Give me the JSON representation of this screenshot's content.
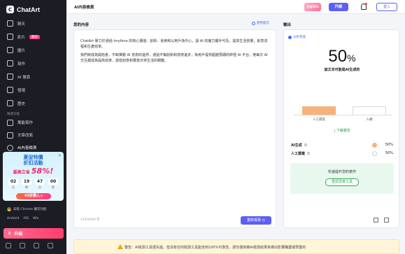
{
  "app": {
    "name": "ChatArt",
    "logo_letter": "C"
  },
  "sidebar": {
    "items": [
      {
        "label": "聊天",
        "icon": "chat-icon"
      },
      {
        "label": "影片",
        "icon": "video-icon",
        "badge": "最新"
      },
      {
        "label": "圖片",
        "icon": "image-icon"
      },
      {
        "label": "寫作",
        "icon": "pen-icon"
      },
      {
        "label": "AI 搜尋",
        "icon": "search-icon"
      },
      {
        "label": "發現",
        "icon": "compass-icon"
      },
      {
        "label": "歷史",
        "icon": "clock-icon"
      }
    ],
    "section_label": "精選功能",
    "features": [
      {
        "label": "萬能寫作",
        "icon": "magic-icon"
      },
      {
        "label": "文章改寫",
        "icon": "rewrite-icon"
      },
      {
        "label": "AI內容檢測",
        "icon": "check-icon",
        "active": true
      }
    ],
    "promo": {
      "title_line1": "夏促特價",
      "title_line2": "折扣活動",
      "sale_prefix": "最高立省",
      "sale_value": "58%!",
      "countdown": [
        {
          "num": "02",
          "unit": "天"
        },
        {
          "num": "19",
          "unit": "時"
        },
        {
          "num": "47",
          "unit": "分"
        },
        {
          "num": "00",
          "unit": "秒"
        }
      ],
      "button": "43折購入 ▸",
      "close": "×"
    },
    "install_label": "安裝 Chrome 擴充功能",
    "platforms": [
      "Android",
      "iOS",
      "Win"
    ],
    "upgrade_label": "升級"
  },
  "header": {
    "title": "AI內容檢測",
    "sale_tag": "立省58%",
    "upgrade": "升級",
    "login": "登入"
  },
  "input": {
    "label": "您的內容",
    "tips": "使用提示",
    "paragraphs": [
      "ChatArt 致力於通過 Imyfone 的核心價值：創新、易用和以用戶為中心，讓 AI 的魔力觸手可及，提高生活質量，創意流程和生產效率。",
      "我們將成為開拓者，不斷推動 AI 技術的邊界，通過不懈創新和技術進步，為用戶提供超越預期的終極 AI 平台，使每次 AI 交互都成為提高效率、激發創意和豐富日常生活的關鍵。"
    ],
    "char_count": "115/4000 字",
    "button": "重新檢測 ◷"
  },
  "output": {
    "label": "輸出",
    "status": "分析完成",
    "percent_value": "50",
    "percent_sign": "%",
    "caption": "該文本可能是AI生成的",
    "download": "下載報告",
    "rows": [
      {
        "name": "AI生成",
        "value": "50%",
        "color": "#f6b27a"
      },
      {
        "name": "人工撰寫",
        "value": "50%",
        "color": "#ffffff"
      }
    ],
    "improve_text": "秒速提升您的寫作",
    "improve_button": "重試改寫工具"
  },
  "chart_data": {
    "type": "bar",
    "categories": [
      "人工撰寫",
      "人類"
    ],
    "values": [
      50,
      50
    ],
    "colors": [
      "#f6b27a",
      "#ffffff"
    ],
    "ylim": [
      0,
      100
    ]
  },
  "warning": "警告：AI檢測工具很先進，但沒有任何檢測工具能達到100%可靠性，請勿僅依賴AI檢測結果來做出影響職業或學業的"
}
